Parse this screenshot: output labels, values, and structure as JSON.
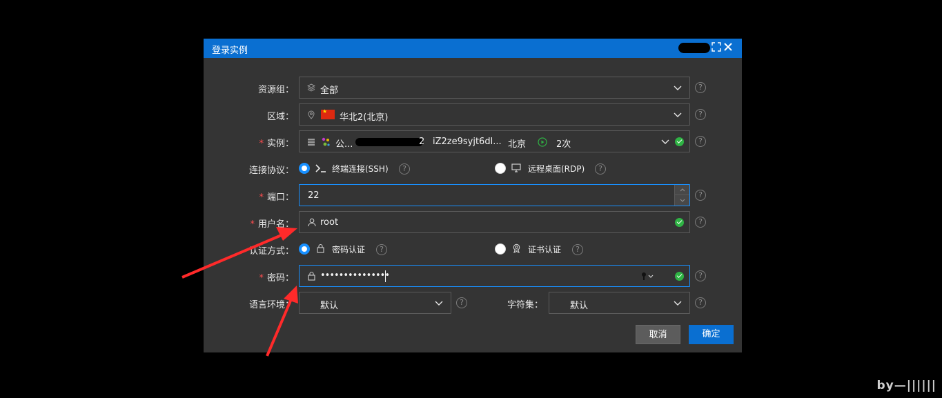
{
  "dialog": {
    "title": "登录实例"
  },
  "form": {
    "resource_group": {
      "label": "资源组：",
      "value": "全部"
    },
    "region": {
      "label": "区域：",
      "value": "华北2(北京)"
    },
    "instance": {
      "label": "实例：",
      "name": "公...",
      "id_suffix": "2",
      "id": "iZ2ze9syjt6dl...",
      "location": "北京",
      "count": "2次"
    },
    "protocol": {
      "label": "连接协议：",
      "ssh": "终端连接(SSH)",
      "rdp": "远程桌面(RDP)",
      "selected": "ssh"
    },
    "port": {
      "label": "端口：",
      "value": "22"
    },
    "username": {
      "label": "用户名：",
      "value": "root"
    },
    "auth": {
      "label": "认证方式：",
      "password_option": "密码认证",
      "cert_option": "证书认证",
      "selected": "password"
    },
    "password": {
      "label": "密码：",
      "value": "•••••••••••••••"
    },
    "locale": {
      "label": "语言环境：",
      "value": "默认"
    },
    "charset": {
      "label": "字符集：",
      "value": "默认"
    },
    "required_mark": "*",
    "help_mark": "?"
  },
  "buttons": {
    "cancel": "取消",
    "confirm": "确定"
  },
  "watermark": "by—||||||",
  "colors": {
    "accent": "#0a6fd1",
    "focus_border": "#1890ff",
    "success": "#2fb344",
    "required": "#ff4d4f",
    "annotation_arrow": "#ff2a2a"
  }
}
